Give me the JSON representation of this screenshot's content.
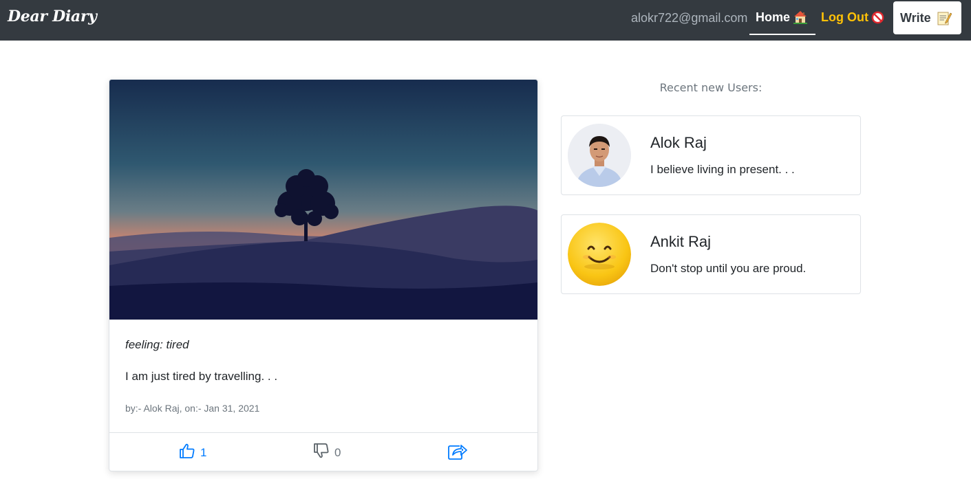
{
  "navbar": {
    "brand": "Dear Diary",
    "email": "alokr722@gmail.com",
    "home_label": "Home",
    "home_icon": "house-icon",
    "logout_label": "Log Out",
    "logout_icon": "prohibited-icon",
    "write_label": "Write",
    "write_icon": "memo-icon"
  },
  "post": {
    "image_icon": "night-landscape-image",
    "feeling": "feeling: tired",
    "content": "I am just tired by travelling. . .",
    "meta": "by:- Alok Raj, on:- Jan 31, 2021",
    "actions": {
      "like_count": "1",
      "dislike_count": "0"
    }
  },
  "sidebar": {
    "title": "Recent new Users:",
    "users": [
      {
        "name": "Alok Raj",
        "bio": "I believe living in present. . ."
      },
      {
        "name": "Ankit Raj",
        "bio": "Don't stop until you are proud."
      }
    ]
  },
  "colors": {
    "navbar_bg": "#343a40",
    "logout": "#ffc107",
    "like_blue": "#007bff",
    "muted": "#6c757d"
  }
}
